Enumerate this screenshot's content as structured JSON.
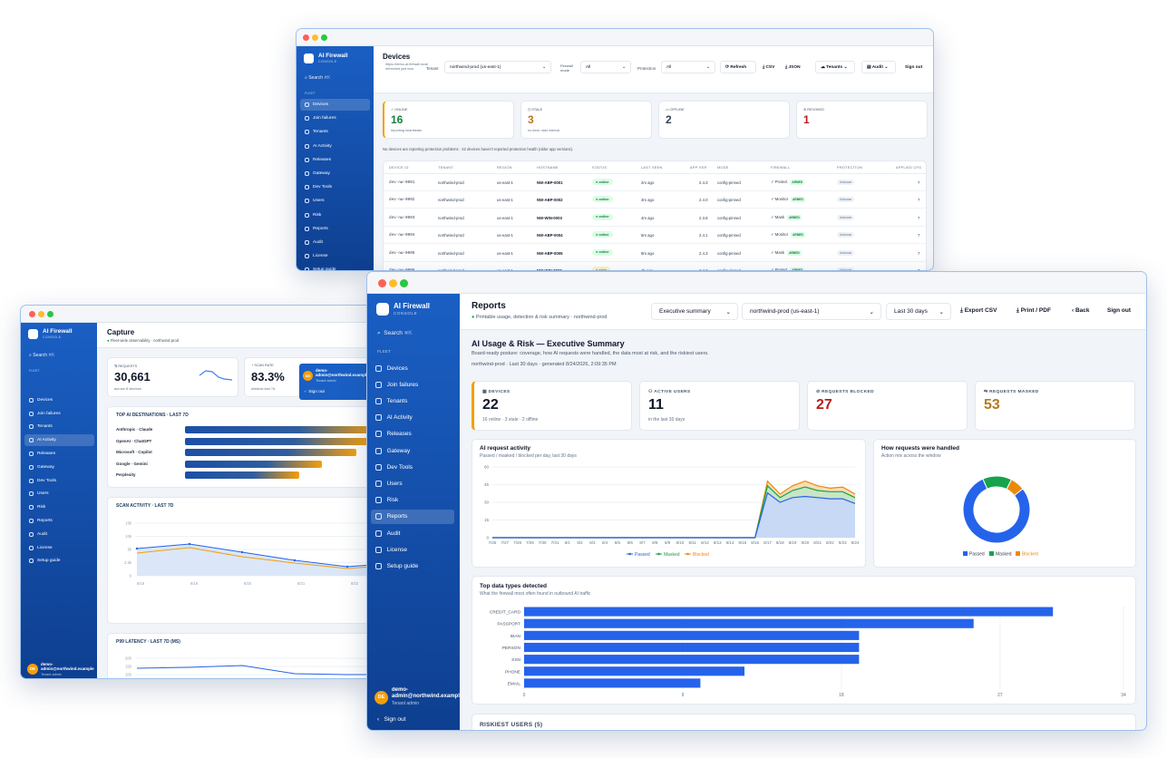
{
  "brand": {
    "name": "AI Firewall",
    "sub": "CONSOLE"
  },
  "colors": {
    "sidebar": "#1556b8",
    "passed": "#2563eb",
    "masked": "#16a34a",
    "blocked": "#ea8a0c",
    "online": "#15803d",
    "stale": "#b7791f",
    "blocked_red": "#b91c1c"
  },
  "search": {
    "label": "Search",
    "kbd": "⌘K"
  },
  "fleet_label": "FLEET",
  "nav_full": [
    "Devices",
    "Join failures",
    "Tenants",
    "AI Activity",
    "Releases",
    "Gateway",
    "Dev Tools",
    "Users",
    "Risk",
    "Reports",
    "Audit",
    "License",
    "Setup guide"
  ],
  "nav_devices": [
    "Devices",
    "Join failures",
    "Tenants",
    "AI Activity",
    "Releases",
    "Gateway",
    "Dev Tools",
    "Users",
    "Risk",
    "Reports",
    "Audit",
    "License",
    "Setup guide"
  ],
  "user": {
    "initials": "DE",
    "name": "demo-admin@northwind.example",
    "role": "Tenant admin",
    "signout": "Sign out"
  },
  "devices": {
    "title": "Devices",
    "url": "https://demo.ai-firewall.local",
    "refreshed": "refreshed just now",
    "tenant_label": "Tenant",
    "tenant_value": "northwind-prod (us-east-1)",
    "mode_label": "Firewall mode",
    "mode_value": "All",
    "prot_label": "Protection",
    "prot_value": "All",
    "btn_refresh": "Refresh",
    "btn_csv": "CSV",
    "btn_json": "JSON",
    "btn_tenants": "Tenants",
    "btn_audit": "Audit",
    "btn_signout": "Sign out",
    "stats": [
      {
        "label": "ONLINE",
        "value": "16",
        "sub": "reporting heartbeats"
      },
      {
        "label": "STALE",
        "value": "3",
        "sub": "no beat >last interval"
      },
      {
        "label": "OFFLINE",
        "value": "2",
        "sub": ""
      },
      {
        "label": "REVOKED",
        "value": "1",
        "sub": ""
      }
    ],
    "notice": "No devices are reporting protection problems · 22 devices haven't reported protection health (older app versions).",
    "columns": [
      "DEVICE ID",
      "TENANT",
      "REGION",
      "HOSTNAME",
      "STATUS",
      "LAST SEEN",
      "APP VER",
      "MODE",
      "FIREWALL",
      "PROTECTION",
      "APPLIED CFG"
    ],
    "rows": [
      [
        "dev-nw-0001",
        "northwind-prod",
        "us-east-1",
        "NW-ABP-0001",
        "online",
        "2m ago",
        "2.4.3",
        "config-pinned",
        "Protect",
        "ARMED",
        "Unknown",
        "7"
      ],
      [
        "dev-nw-0002",
        "northwind-prod",
        "us-east-1",
        "NW-ABP-0002",
        "online",
        "3m ago",
        "2.4.0",
        "config-pinned",
        "Monitor",
        "ARMED",
        "Unknown",
        "7"
      ],
      [
        "dev-nw-0003",
        "northwind-prod",
        "us-east-1",
        "NW-WIN-0003",
        "online",
        "4m ago",
        "2.3.8",
        "config-pinned",
        "Mask",
        "ARMED",
        "Unknown",
        "7"
      ],
      [
        "dev-nw-0004",
        "northwind-prod",
        "us-east-1",
        "NW-ABP-0004",
        "online",
        "5m ago",
        "2.4.1",
        "config-pinned",
        "Monitor",
        "ARMED",
        "Unknown",
        "7"
      ],
      [
        "dev-nw-0005",
        "northwind-prod",
        "us-east-1",
        "NW-ABP-0005",
        "online",
        "8m ago",
        "2.4.3",
        "config-pinned",
        "Mask",
        "ARMED",
        "Unknown",
        "7"
      ],
      [
        "dev-nw-0006",
        "northwind-prod",
        "us-east-1",
        "NW-WIN-0006",
        "stale",
        "4h ago",
        "2.4.3",
        "config-pinned",
        "Protect",
        "ARMED",
        "Unknown",
        "7"
      ]
    ]
  },
  "capture": {
    "title": "Capture",
    "subtitle": "Fleet-wide observability · northwind-prod",
    "requests_label": "REQUESTS",
    "requests_value": "30,661",
    "requests_sub": "across 8 devices",
    "scan_label": "SCAN RATE",
    "scan_value": "83.3%",
    "scan_sub": "window last 7d",
    "dest_title": "TOP AI DESTINATIONS · LAST 7D",
    "destinations": [
      {
        "name": "Anthropic · Claude",
        "fill": 1.0
      },
      {
        "name": "OpenAI · ChatGPT",
        "fill": 0.96
      },
      {
        "name": "Microsoft · Copilot",
        "fill": 0.9
      },
      {
        "name": "Google · Gemini",
        "fill": 0.72
      },
      {
        "name": "Perplexity",
        "fill": 0.6
      }
    ],
    "scan_title": "SCAN ACTIVITY · LAST 7D",
    "scan_yticks": [
      "15k",
      "10k",
      "5k",
      "2.5k",
      "0"
    ],
    "scan_xticks": [
      "8/18",
      "8/19",
      "8/20",
      "8/21",
      "8/22"
    ],
    "latency_title": "P99 LATENCY · LAST 7D (MS)",
    "lat_yticks": [
      "200",
      "150",
      "100"
    ]
  },
  "reports": {
    "title": "Reports",
    "subtitle": "Printable usage, detection & risk summary · northwind-prod",
    "select_summary": "Executive summary",
    "select_tenant": "northwind-prod (us-east-1)",
    "select_range": "Last 30 days",
    "btn_csv": "Export CSV",
    "btn_pdf": "Print / PDF",
    "btn_back": "Back",
    "btn_signout": "Sign out",
    "heading": "AI Usage & Risk — Executive Summary",
    "desc": "Board-ready posture: coverage, how AI requests were handled, the data most at risk, and the riskiest users.",
    "meta": "northwind-prod · Last 30 days · generated 8/24/2026, 2:09:35 PM",
    "kpis": [
      {
        "label": "DEVICES",
        "value": "22",
        "sub": "16 online · 3 stale · 2 offline"
      },
      {
        "label": "ACTIVE USERS",
        "value": "11",
        "sub": "in the last 30 days"
      },
      {
        "label": "REQUESTS BLOCKED",
        "value": "27",
        "sub": ""
      },
      {
        "label": "REQUESTS MASKED",
        "value": "53",
        "sub": ""
      }
    ],
    "activity_title": "AI request activity",
    "activity_sub": "Passed / masked / blocked per day, last 30 days",
    "handled_title": "How requests were handled",
    "handled_sub": "Action mix across the window",
    "types_title": "Top data types detected",
    "types_sub": "What the firewall most often found in outbound AI traffic",
    "riskiest": "RISKIEST USERS (5)"
  },
  "chart_data": [
    {
      "type": "area",
      "title": "AI request activity",
      "x": [
        "7/26",
        "7/27",
        "7/28",
        "7/29",
        "7/30",
        "7/31",
        "8/1",
        "8/2",
        "8/3",
        "8/4",
        "8/5",
        "8/6",
        "8/7",
        "8/8",
        "8/9",
        "8/10",
        "8/11",
        "8/12",
        "8/13",
        "8/14",
        "8/15",
        "8/16",
        "8/17",
        "8/18",
        "8/19",
        "8/20",
        "8/21",
        "8/22",
        "8/23",
        "8/24"
      ],
      "ylim": [
        0,
        60
      ],
      "yticks": [
        0,
        15,
        30,
        45,
        60
      ],
      "series": [
        {
          "name": "Passed",
          "values": [
            0,
            0,
            0,
            0,
            0,
            0,
            0,
            0,
            0,
            0,
            0,
            0,
            0,
            0,
            0,
            0,
            0,
            0,
            0,
            0,
            0,
            0,
            38,
            30,
            34,
            35,
            34,
            33,
            33,
            29
          ]
        },
        {
          "name": "Masked",
          "values": [
            0,
            0,
            0,
            0,
            0,
            0,
            0,
            0,
            0,
            0,
            0,
            0,
            0,
            0,
            0,
            0,
            0,
            0,
            0,
            0,
            0,
            0,
            6,
            4,
            6,
            8,
            6,
            6,
            6,
            5
          ]
        },
        {
          "name": "Blocked",
          "values": [
            0,
            0,
            0,
            0,
            0,
            0,
            0,
            0,
            0,
            0,
            0,
            0,
            0,
            0,
            0,
            0,
            0,
            0,
            0,
            0,
            0,
            0,
            4,
            3,
            4,
            5,
            4,
            3,
            4,
            3
          ]
        }
      ],
      "legend": "bottom"
    },
    {
      "type": "pie",
      "title": "How requests were handled",
      "labels": [
        "Passed",
        "Masked",
        "Blocked"
      ],
      "values": [
        0.79,
        0.14,
        0.07
      ],
      "legend": "bottom"
    },
    {
      "type": "bar",
      "title": "Top data types detected",
      "categories": [
        "CREDIT_CARD",
        "PASSPORT",
        "IBAN",
        "PERSON",
        "SSN",
        "PHONE",
        "EMAIL"
      ],
      "values": [
        30,
        25.5,
        19,
        19,
        19,
        12.5,
        10
      ],
      "xlim": [
        0,
        34
      ],
      "xticks": [
        0,
        9,
        18,
        27,
        34
      ]
    }
  ]
}
